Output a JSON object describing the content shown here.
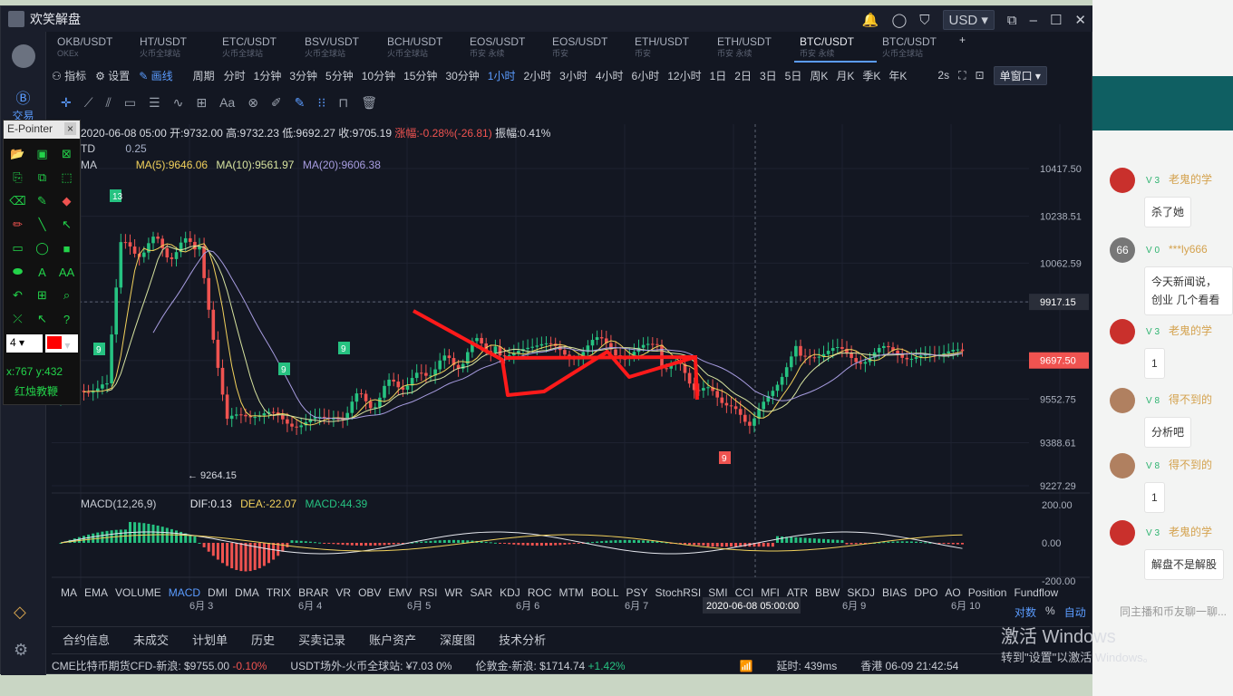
{
  "app": {
    "title": "欢笑解盘",
    "currency": "USD"
  },
  "left_nav": {
    "trade": "交易"
  },
  "tabs": [
    {
      "label": "OKB/USDT",
      "sub": "OKEx"
    },
    {
      "label": "HT/USDT",
      "sub": "火币全球站"
    },
    {
      "label": "ETC/USDT",
      "sub": "火币全球站"
    },
    {
      "label": "BSV/USDT",
      "sub": "火币全球站"
    },
    {
      "label": "BCH/USDT",
      "sub": "火币全球站"
    },
    {
      "label": "EOS/USDT",
      "sub": "币安 永续"
    },
    {
      "label": "EOS/USDT",
      "sub": "币安"
    },
    {
      "label": "ETH/USDT",
      "sub": "币安"
    },
    {
      "label": "ETH/USDT",
      "sub": "币安 永续"
    },
    {
      "label": "BTC/USDT",
      "sub": "币安 永续"
    },
    {
      "label": "BTC/USDT",
      "sub": "火币全球站"
    }
  ],
  "toolbar": {
    "indicator": "指标",
    "settings": "设置",
    "draw": "画线",
    "period": "周期",
    "periods": [
      "分时",
      "1分钟",
      "3分钟",
      "5分钟",
      "10分钟",
      "15分钟",
      "30分钟",
      "1小时",
      "2小时",
      "3小时",
      "4小时",
      "6小时",
      "12小时",
      "1日",
      "2日",
      "3日",
      "5日",
      "周K",
      "月K",
      "季K",
      "年K"
    ],
    "active_period": "1小时",
    "refresh": "2s",
    "window": "单窗口"
  },
  "info": {
    "date": "2020-06-08 05:00",
    "open": "开:9732.00",
    "high": "高:9732.23",
    "low": "低:9692.27",
    "close": "收:9705.19",
    "change": "涨幅:-0.28%(-26.81)",
    "amplitude": "振幅:0.41%"
  },
  "td": {
    "label": "TD",
    "value": "0.25"
  },
  "ma": {
    "label": "MA",
    "ma5": "MA(5):9646.06",
    "ma10": "MA(10):9561.97",
    "ma20": "MA(20):9606.38"
  },
  "macd": {
    "label": "MACD(12,26,9)",
    "dif": "DIF:0.13",
    "dea": "DEA:-22.07",
    "macd": "MACD:44.39"
  },
  "price_axis": [
    "10417.50",
    "10238.51",
    "10062.59",
    "9917.15",
    "9697.50",
    "9552.75",
    "9388.61",
    "9227.29"
  ],
  "macd_axis": [
    "200.00",
    "0.00",
    "-200.00"
  ],
  "date_axis": [
    "6月 3",
    "6月 4",
    "6月 5",
    "6月 6",
    "6月 7",
    "2020-06-08 05:00:00",
    "6月 9",
    "6月 10"
  ],
  "low_label": "9264.15",
  "td_markers": [
    "13",
    "9",
    "9",
    "9",
    "9"
  ],
  "indicators": [
    "MA",
    "EMA",
    "VOLUME",
    "MACD",
    "DMI",
    "DMA",
    "TRIX",
    "BRAR",
    "VR",
    "OBV",
    "EMV",
    "RSI",
    "WR",
    "SAR",
    "KDJ",
    "ROC",
    "MTM",
    "BOLL",
    "PSY",
    "StochRSI",
    "SMI",
    "CCI",
    "MFI",
    "ATR",
    "BBW",
    "SKDJ",
    "BIAS",
    "DPO",
    "AO",
    "Position",
    "Fundflow"
  ],
  "active_indicator": "MACD",
  "axis_opts": {
    "ratio": "对数",
    "percent": "%",
    "auto": "自动"
  },
  "bottom_tabs": [
    "合约信息",
    "未成交",
    "计划单",
    "历史",
    "买卖记录",
    "账户资产",
    "深度图",
    "技术分析"
  ],
  "status": {
    "cme": "CME比特币期货CFD-新浪: $9755.00",
    "cme_chg": "-0.10%",
    "usdt": "USDT场外-火币全球站: ¥7.03 0%",
    "gold": "伦敦金-新浪: $1714.74",
    "gold_chg": "+1.42%",
    "latency": "延时: 439ms",
    "clock": "香港 06-09 21:42:54"
  },
  "epointer": {
    "title": "E-Pointer",
    "size": "4",
    "coords": "x:767  y:432",
    "caption": "红烛教鞭"
  },
  "chat": [
    {
      "level": "3",
      "name": "老鬼的学",
      "text": "杀了她"
    },
    {
      "level": "0",
      "name": "***ly666",
      "text": "今天新闻说，创业 几个看看",
      "avatar": "66"
    },
    {
      "level": "3",
      "name": "老鬼的学",
      "text": "1"
    },
    {
      "level": "8",
      "name": "得不到的",
      "text": "分析吧"
    },
    {
      "level": "8",
      "name": "得不到的",
      "text": "1"
    },
    {
      "level": "3",
      "name": "老鬼的学",
      "text": "解盘不是解股"
    }
  ],
  "chat_input": "同主播和币友聊一聊...",
  "watermark": {
    "line1": "激活 Windows",
    "line2": "转到\"设置\"以激活 Windows。"
  },
  "colors": {
    "bg": "#131722",
    "up": "#26c281",
    "down": "#ef5350",
    "accent": "#5b9cff",
    "draw": "#ff1a1a"
  }
}
